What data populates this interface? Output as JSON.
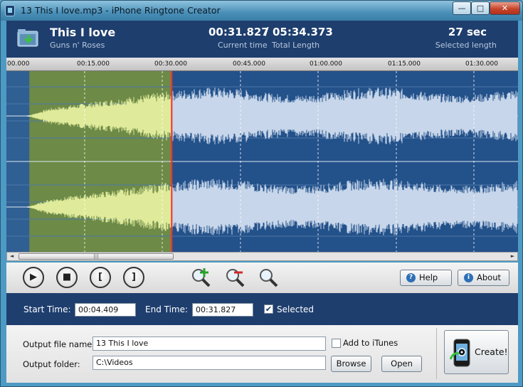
{
  "window": {
    "title": "13 This I love.mp3 - iPhone Ringtone Creator",
    "min_glyph": "—",
    "max_glyph": "□",
    "close_glyph": "✕"
  },
  "header": {
    "song_title": "This I love",
    "artist": "Guns n' Roses",
    "current_time": "00:31.827",
    "separator": "/",
    "total_length": "05:34.373",
    "current_time_label": "Current time",
    "total_length_label": "Total Length",
    "selected_length": "27 sec",
    "selected_length_label": "Selected length"
  },
  "ruler": {
    "ticks": [
      "00.000",
      "00:15.000",
      "00:30.000",
      "00:45.000",
      "01:00.000",
      "01:15.000",
      "01:30.000"
    ]
  },
  "waveform": {
    "selection_start_sec": 4.409,
    "selection_end_sec": 31.827,
    "cursor_sec": 31.827,
    "visible_duration_sec": 98.5,
    "colors": {
      "background": "#23518a",
      "selection_bg": "#6d8a47",
      "wave": "#c7d6ea",
      "wave_selected": "#dfeb9a",
      "cursor": "#ff2a2a"
    }
  },
  "scrollbar": {
    "left_glyph": "◄",
    "right_glyph": "►",
    "thumb_grip": "|||"
  },
  "controls": {
    "play_icon": "▶",
    "stop_icon": "■",
    "mark_start": "[",
    "mark_end": "]",
    "help_label": "Help",
    "about_label": "About",
    "help_icon": "?",
    "about_icon": "i"
  },
  "timebar": {
    "start_label": "Start Time:",
    "start_value": "00:04.409",
    "end_label": "End Time:",
    "end_value": "00:31.827",
    "selected_label": "Selected",
    "selected_checked": "✔"
  },
  "output": {
    "file_name_label": "Output file name:",
    "file_name_value": "13 This I love",
    "folder_label": "Output folder:",
    "folder_value": "C:\\Videos",
    "add_itunes_label": "Add to iTunes",
    "browse_label": "Browse",
    "open_label": "Open",
    "create_label": "Create!"
  }
}
